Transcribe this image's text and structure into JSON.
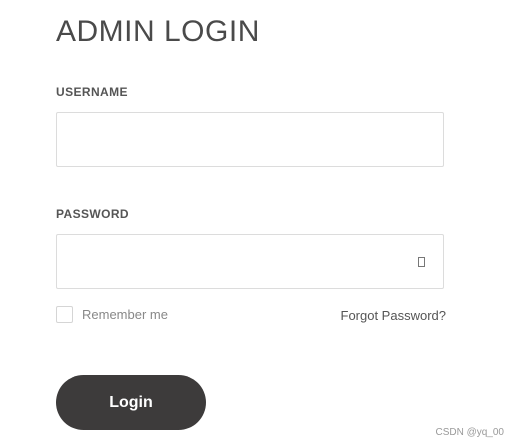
{
  "page": {
    "title": "ADMIN LOGIN"
  },
  "form": {
    "username": {
      "label": "USERNAME",
      "value": "",
      "placeholder": ""
    },
    "password": {
      "label": "PASSWORD",
      "value": "",
      "placeholder": "",
      "toggle_icon": "eye-icon"
    },
    "remember": {
      "label": "Remember me",
      "checked": false
    },
    "forgot_label": "Forgot Password?",
    "login_label": "Login"
  },
  "watermark": "CSDN @yq_00",
  "colors": {
    "button_bg": "#3d3b3b",
    "text": "#444444",
    "border": "#dcdcdc"
  }
}
